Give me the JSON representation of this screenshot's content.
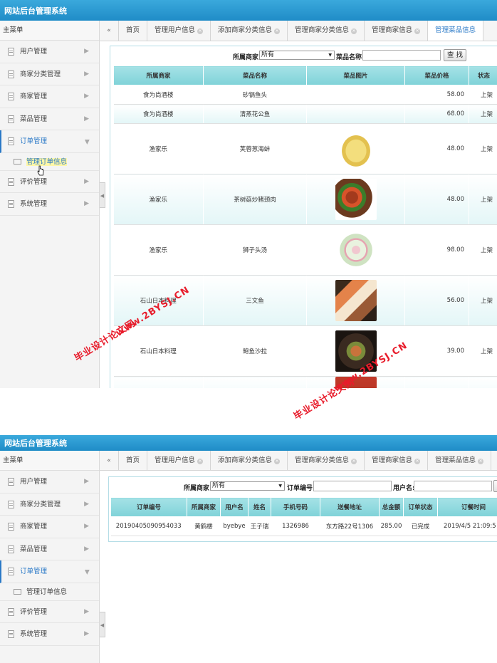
{
  "app_title": "网站后台管理系统",
  "sidebar": {
    "heading": "主菜单",
    "items": [
      {
        "label": "用户管理"
      },
      {
        "label": "商家分类管理"
      },
      {
        "label": "商家管理"
      },
      {
        "label": "菜品管理"
      },
      {
        "label": "订单管理"
      },
      {
        "label": "评价管理"
      },
      {
        "label": "系统管理"
      }
    ],
    "sub_item": "管理订单信息"
  },
  "tabs": {
    "prev_icon": "«",
    "s1": [
      "首页",
      "管理用户信息",
      "添加商家分类信息",
      "管理商家分类信息",
      "管理商家信息",
      "管理菜品信息"
    ],
    "s2": [
      "首页",
      "管理用户信息",
      "添加商家分类信息",
      "管理商家分类信息",
      "管理商家信息",
      "管理菜品信息"
    ]
  },
  "dish_page": {
    "filter": {
      "merchant_label": "所属商家",
      "merchant_value": "所有",
      "name_label": "菜品名称:",
      "name_value": "",
      "search_button": "查 找"
    },
    "columns": [
      "所属商家",
      "菜品名称",
      "菜品图片",
      "菜品价格",
      "状态"
    ],
    "rows": [
      {
        "merchant": "食为尚酒楼",
        "name": "砂锅鱼头",
        "image": "",
        "price": "58.00",
        "status": "上架"
      },
      {
        "merchant": "食为尚酒楼",
        "name": "清蒸花公鱼",
        "image": "",
        "price": "68.00",
        "status": "上架"
      },
      {
        "merchant": "渔家乐",
        "name": "芙蓉葱海蚌",
        "image": "dish-photo",
        "price": "48.00",
        "status": "上架"
      },
      {
        "merchant": "渔家乐",
        "name": "茶树菇炒猪颈肉",
        "image": "dish-photo",
        "price": "48.00",
        "status": "上架"
      },
      {
        "merchant": "渔家乐",
        "name": "狮子头汤",
        "image": "dish-photo",
        "price": "98.00",
        "status": "上架"
      },
      {
        "merchant": "石山日本料理",
        "name": "三文鱼",
        "image": "dish-photo",
        "price": "56.00",
        "status": "上架"
      },
      {
        "merchant": "石山日本料理",
        "name": "鲍鱼沙拉",
        "image": "dish-photo",
        "price": "39.00",
        "status": "上架"
      }
    ]
  },
  "order_page": {
    "filter": {
      "merchant_label": "所属商家",
      "merchant_value": "所有",
      "order_no_label": "订单编号:",
      "order_no_value": "",
      "user_label": "用户名:",
      "user_value": ""
    },
    "columns": [
      "订单编号",
      "所属商家",
      "用户名",
      "姓名",
      "手机号码",
      "送餐地址",
      "总金额",
      "订单状态",
      "订餐时间"
    ],
    "rows": [
      {
        "order_no": "20190405090954033",
        "merchant": "黄鹤楼",
        "user": "byebye",
        "name": "王子瑞",
        "phone": "1326986",
        "address": "东方路22号1306",
        "amount": "285.00",
        "status": "已完成",
        "time": "2019/4/5 21:09:5"
      }
    ]
  },
  "watermark": {
    "text_cn": "毕业设计论文网",
    "text_url": "www.2BYSJ.CN",
    "color": "#e81c2b"
  },
  "colors": {
    "header": "#1f8cc7",
    "active": "#2a79c7",
    "table_header": "#8fd8dd"
  }
}
